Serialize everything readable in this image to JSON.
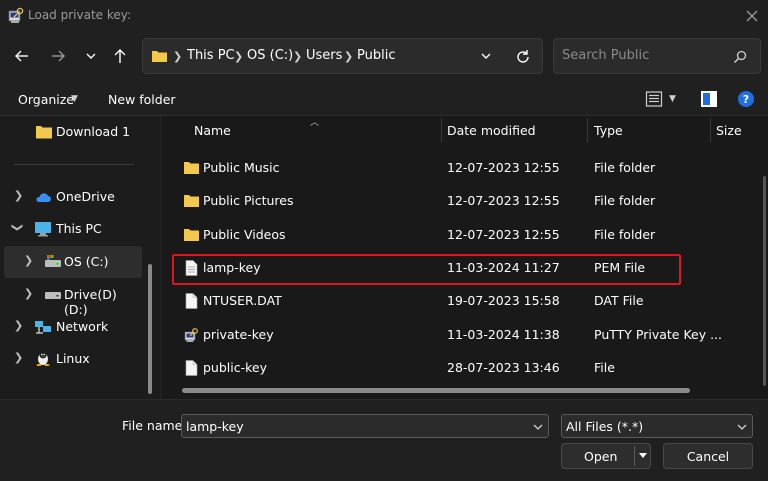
{
  "window": {
    "title": "Load private key:",
    "icons": {
      "app": "putty-key-icon",
      "close": "close-icon"
    }
  },
  "nav": {
    "back": "arrow-left-icon",
    "forward": "arrow-right-icon",
    "recent": "chevron-down-icon",
    "up": "arrow-up-icon",
    "breadcrumb": [
      "This PC",
      "OS (C:)",
      "Users",
      "Public"
    ],
    "search_placeholder": "Search Public"
  },
  "toolbar": {
    "organize": "Organize",
    "new_folder": "New folder"
  },
  "sidebar": {
    "items": [
      {
        "label": "Download 1",
        "icon": "folder-icon",
        "expander": false
      },
      {
        "label": "OneDrive",
        "icon": "cloud-icon",
        "expander": "collapsed"
      },
      {
        "label": "This PC",
        "icon": "monitor-icon",
        "expander": "expanded"
      },
      {
        "label": "OS (C:)",
        "icon": "os-drive-icon",
        "expander": "collapsed",
        "selected": true
      },
      {
        "label": "Drive(D) (D:)",
        "icon": "drive-icon",
        "expander": "collapsed"
      },
      {
        "label": "Network",
        "icon": "network-icon",
        "expander": "collapsed"
      },
      {
        "label": "Linux",
        "icon": "linux-icon",
        "expander": "collapsed"
      }
    ]
  },
  "files": {
    "columns": [
      "Name",
      "Date modified",
      "Type",
      "Size"
    ],
    "rows": [
      {
        "name": "Public Music",
        "date": "12-07-2023 12:55",
        "type": "File folder",
        "icon": "folder-icon"
      },
      {
        "name": "Public Pictures",
        "date": "12-07-2023 12:55",
        "type": "File folder",
        "icon": "folder-icon"
      },
      {
        "name": "Public Videos",
        "date": "12-07-2023 12:55",
        "type": "File folder",
        "icon": "folder-icon"
      },
      {
        "name": "lamp-key",
        "date": "11-03-2024 11:27",
        "type": "PEM File",
        "icon": "file-icon",
        "highlighted": true
      },
      {
        "name": "NTUSER.DAT",
        "date": "19-07-2023 15:58",
        "type": "DAT File",
        "icon": "file-icon"
      },
      {
        "name": "private-key",
        "date": "11-03-2024 11:38",
        "type": "PuTTY Private Key ...",
        "icon": "putty-key-icon"
      },
      {
        "name": "public-key",
        "date": "28-07-2023 13:46",
        "type": "File",
        "icon": "file-icon"
      }
    ]
  },
  "footer": {
    "file_name_label": "File name:",
    "file_name_value": "lamp-key",
    "file_type_value": "All Files (*.*)",
    "open_label": "Open",
    "cancel_label": "Cancel"
  },
  "colors": {
    "background": "#202020",
    "list_background": "#191919",
    "highlight_border": "#e0141e",
    "folder": "#f2c94c",
    "accent": "#1f6fe0"
  }
}
